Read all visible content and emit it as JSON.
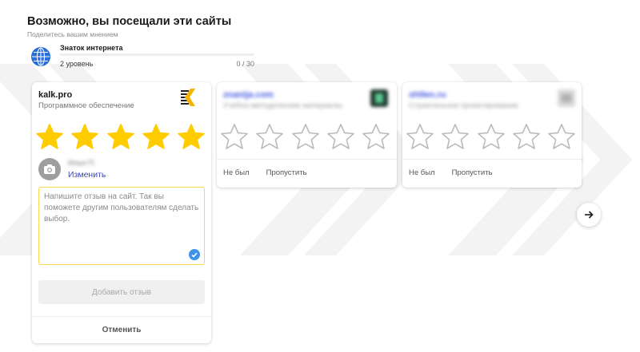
{
  "header": {
    "title": "Возможно, вы посещали эти сайты",
    "subtitle": "Поделитесь вашим мнением"
  },
  "badge": {
    "icon": "globe-icon",
    "name": "Знаток интернета",
    "level": "2 уровень",
    "progress_text": "0 / 30",
    "progress_fraction": 0
  },
  "main_card": {
    "site": "kalk.pro",
    "category": "Программное обеспечение",
    "logo_icon": "kalk-logo-icon",
    "rating": 5,
    "max_rating": 5,
    "user_name": "Илья П.",
    "change_label": "Изменить",
    "review_placeholder": "Напишите отзыв на сайт. Так вы поможете другим пользователям сделать выбор.",
    "review_value": "",
    "add_button": "Добавить отзыв",
    "cancel_button": "Отменить"
  },
  "other_cards": [
    {
      "site": "znanija.com",
      "category": "Учебно-методические материалы",
      "logo_icon": "site-logo-icon",
      "not_visited": "Не был",
      "skip": "Пропустить"
    },
    {
      "site": "shtlen.ru",
      "category": "Строительное проектирование",
      "logo_icon": "site-logo-icon",
      "not_visited": "Не был",
      "skip": "Пропустить"
    }
  ],
  "colors": {
    "star_filled": "#FFCC00",
    "star_outline": "#BBBBBB",
    "link": "#3C45B7",
    "accent_border": "#FFD84D",
    "check": "#3D93E8"
  },
  "next_icon": "arrow-right-icon"
}
